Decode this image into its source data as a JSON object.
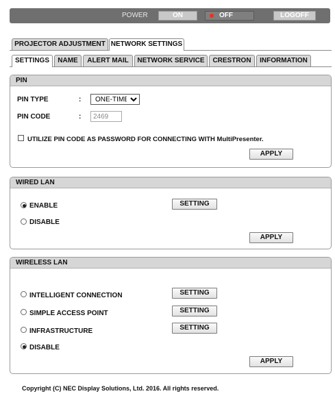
{
  "powerbar": {
    "power_label": "POWER",
    "on_label": "ON",
    "off_label": "OFF",
    "logoff_label": "LOGOFF"
  },
  "main_tabs": [
    {
      "label": "PROJECTOR ADJUSTMENT",
      "active": false
    },
    {
      "label": "NETWORK SETTINGS",
      "active": true
    }
  ],
  "sub_tabs": [
    {
      "label": "SETTINGS",
      "active": true
    },
    {
      "label": "NAME",
      "active": false
    },
    {
      "label": "ALERT MAIL",
      "active": false
    },
    {
      "label": "NETWORK SERVICE",
      "active": false
    },
    {
      "label": "CRESTRON",
      "active": false
    },
    {
      "label": "INFORMATION",
      "active": false
    }
  ],
  "pin": {
    "title": "PIN",
    "pin_type_label": "PIN TYPE",
    "pin_type_colon": ":",
    "pin_type_value": "ONE-TIME",
    "pin_code_label": "PIN CODE",
    "pin_code_colon": ":",
    "pin_code_value": "2469",
    "utilize_label": "UTILIZE PIN CODE AS PASSWORD FOR CONNECTING WITH MultiPresenter.",
    "utilize_checked": false,
    "apply_label": "APPLY"
  },
  "wired_lan": {
    "title": "WIRED LAN",
    "options": [
      {
        "label": "ENABLE",
        "selected": true
      },
      {
        "label": "DISABLE",
        "selected": false
      }
    ],
    "setting_label": "SETTING",
    "apply_label": "APPLY"
  },
  "wireless_lan": {
    "title": "WIRELESS LAN",
    "options": [
      {
        "label": "INTELLIGENT CONNECTION",
        "selected": false,
        "setting_label": "SETTING"
      },
      {
        "label": "SIMPLE ACCESS POINT",
        "selected": false,
        "setting_label": "SETTING"
      },
      {
        "label": "INFRASTRUCTURE",
        "selected": false,
        "setting_label": "SETTING"
      },
      {
        "label": "DISABLE",
        "selected": true
      }
    ],
    "apply_label": "APPLY"
  },
  "footer": {
    "copyright": "Copyright (C) NEC Display Solutions, Ltd. 2016. All rights reserved."
  },
  "colors": {
    "powerbar_bg": "#6f6f6f",
    "off_indicator": "#ff2a1a",
    "section_header_bg": "#d6d6d6"
  }
}
